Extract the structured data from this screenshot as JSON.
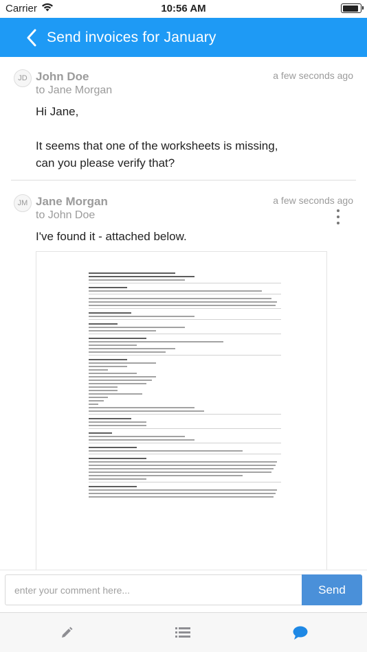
{
  "status": {
    "carrier": "Carrier",
    "time": "10:56 AM",
    "battery_level": 0.95
  },
  "nav": {
    "title": "Send invoices for January",
    "back_icon": "chevron-left-icon"
  },
  "messages": [
    {
      "avatar_initials": "JD",
      "sender": "John Doe",
      "recipient": "to Jane Morgan",
      "timestamp": "a few seconds ago",
      "greeting": "Hi Jane,",
      "body_line_1": "It seems that one of the worksheets is missing,",
      "body_line_2": "can you please verify that?"
    },
    {
      "avatar_initials": "JM",
      "sender": "Jane Morgan",
      "recipient": "to John Doe",
      "timestamp": "a few seconds ago",
      "body": "I've found it - attached below.",
      "more_icon": "more-vertical-icon"
    }
  ],
  "comment": {
    "placeholder": "enter your comment here...",
    "value": "",
    "send_label": "Send"
  },
  "tabs": [
    {
      "icon": "pencil-icon",
      "color": "#8e8e93"
    },
    {
      "icon": "list-icon",
      "color": "#8e8e93"
    },
    {
      "icon": "chat-bubble-icon",
      "color": "#1e88e5"
    }
  ],
  "colors": {
    "nav_bg": "#1e9af5",
    "send_bg": "#4a90d9",
    "active_tab": "#1e88e5"
  }
}
